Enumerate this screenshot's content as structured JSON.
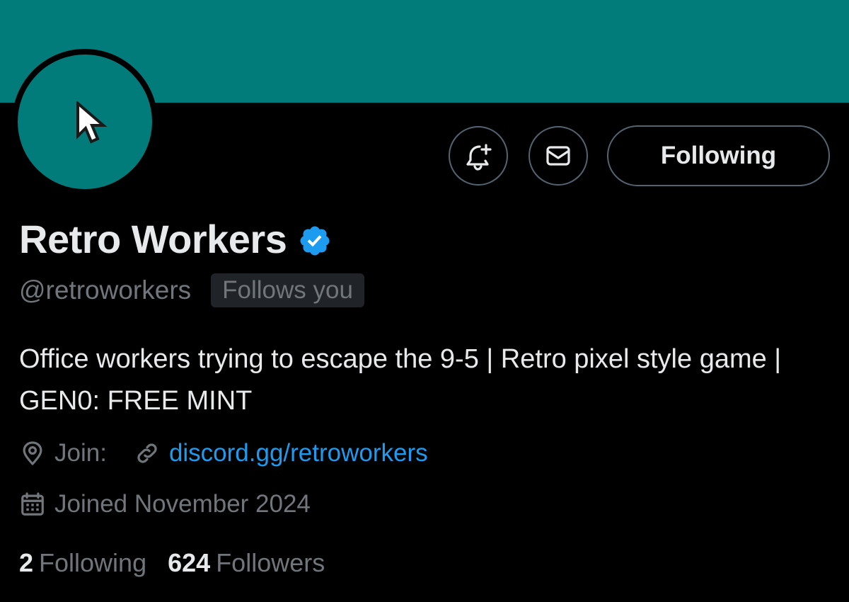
{
  "profile": {
    "display_name": "Retro Workers",
    "handle": "@retroworkers",
    "follows_you_badge": "Follows you",
    "bio": "Office workers trying to escape the 9-5 | Retro pixel style game | GEN0: FREE MINT",
    "location": "Join:",
    "website": "discord.gg/retroworkers",
    "joined": "Joined November 2024"
  },
  "actions": {
    "notify_icon": "bell-plus-icon",
    "message_icon": "envelope-icon",
    "following_label": "Following"
  },
  "stats": {
    "following_count": "2",
    "following_label": "Following",
    "followers_count": "624",
    "followers_label": "Followers"
  },
  "icons": {
    "avatar": "pixel-cursor-icon",
    "verified": "verified-badge-icon",
    "location": "location-pin-icon",
    "link": "link-icon",
    "calendar": "calendar-icon"
  },
  "colors": {
    "banner": "#027b7b",
    "avatar_bg": "#027b7b",
    "background": "#000000",
    "primary_text": "#e7e9ea",
    "secondary_text": "#71767b",
    "link": "#1d9bf0",
    "verified": "#1d9bf0",
    "border": "#536471"
  }
}
